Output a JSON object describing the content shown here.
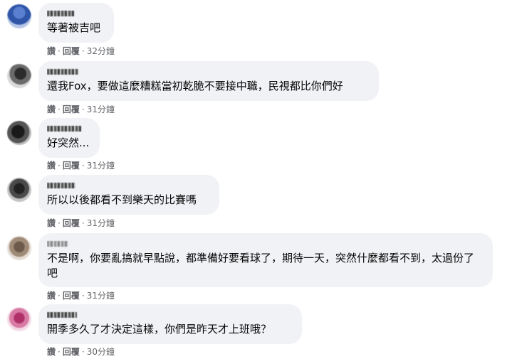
{
  "comments": [
    {
      "text": "等著被吉吧",
      "actions": {
        "like": "讚",
        "separator": "·",
        "reply": "回覆",
        "time": "32分鐘"
      }
    },
    {
      "text": "還我Fox，要做這麼糟糕當初乾脆不要接中職，民視都比你們好",
      "actions": {
        "like": "讚",
        "separator": "·",
        "reply": "回覆",
        "time": "31分鐘"
      }
    },
    {
      "text": "好突然...",
      "actions": {
        "like": "讚",
        "separator": "·",
        "reply": "回覆",
        "time": "31分鐘"
      }
    },
    {
      "text": "所以以後都看不到樂天的比賽嗎",
      "actions": {
        "like": "讚",
        "separator": "·",
        "reply": "回覆",
        "time": "31分鐘"
      }
    },
    {
      "text": "不是啊，你要亂搞就早點說，都準備好要看球了，期待一天，突然什麼都看不到，太過份了吧",
      "actions": {
        "like": "讚",
        "separator": "·",
        "reply": "回覆",
        "time": "31分鐘"
      }
    },
    {
      "text": "開季多久了才決定這樣，你們是昨天才上班哦？",
      "actions": {
        "like": "讚",
        "separator": "·",
        "reply": "回覆",
        "time": "30分鐘"
      }
    }
  ],
  "colors": {
    "bubble": "#f0f2f5",
    "text": "#050505",
    "meta": "#65676b"
  },
  "icons": [
    "avatar-blurred",
    "name-pixelated"
  ]
}
